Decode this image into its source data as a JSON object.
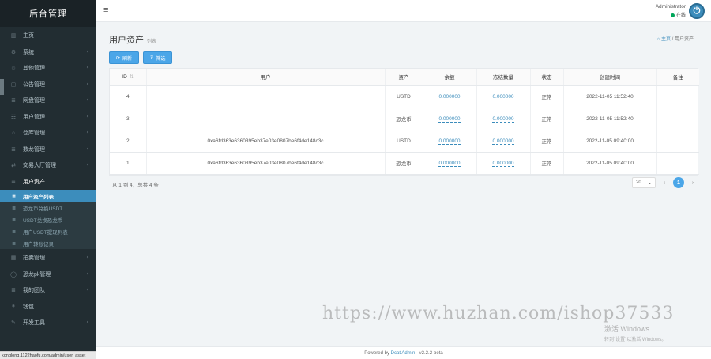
{
  "brand": "后台管理",
  "menu_top": [
    {
      "label": "主页",
      "icon": "dashboard-icon",
      "glyph": "▥",
      "arrow": false
    },
    {
      "label": "系统",
      "icon": "gear-icon",
      "glyph": "⚙",
      "arrow": true
    },
    {
      "label": "其他管理",
      "icon": "user-icon",
      "glyph": "☺",
      "arrow": true
    },
    {
      "label": "公告管理",
      "icon": "calendar-icon",
      "glyph": "▢",
      "arrow": true
    },
    {
      "label": "网盘管理",
      "icon": "list-icon",
      "glyph": "≣",
      "arrow": true
    },
    {
      "label": "用户管理",
      "icon": "users-icon",
      "glyph": "☷",
      "arrow": true
    },
    {
      "label": "仓库管理",
      "icon": "bank-icon",
      "glyph": "⌂",
      "arrow": true
    },
    {
      "label": "数龙管理",
      "icon": "list-icon",
      "glyph": "≣",
      "arrow": true
    },
    {
      "label": "交易大厅管理",
      "icon": "exchange-icon",
      "glyph": "⇄",
      "arrow": true
    },
    {
      "label": "用户资产",
      "icon": "list-icon",
      "glyph": "≣",
      "arrow": false,
      "open": true
    }
  ],
  "submenu": [
    {
      "label": "用户资产列表",
      "active": true
    },
    {
      "label": "恐龙币兑换USDT",
      "active": false
    },
    {
      "label": "USDT兑换恐龙币",
      "active": false
    },
    {
      "label": "用户USDT提现列表",
      "active": false
    },
    {
      "label": "用户转账记录",
      "active": false
    }
  ],
  "menu_bottom": [
    {
      "label": "拍卖管理",
      "icon": "grid-icon",
      "glyph": "▦",
      "arrow": true
    },
    {
      "label": "恐龙pk管理",
      "icon": "circle-icon",
      "glyph": "◯",
      "arrow": true
    },
    {
      "label": "我的团队",
      "icon": "list-icon",
      "glyph": "≣",
      "arrow": true
    },
    {
      "label": "钱包",
      "icon": "yen-icon",
      "glyph": "¥",
      "arrow": false
    },
    {
      "label": "开发工具",
      "icon": "tools-icon",
      "glyph": "✎",
      "arrow": true
    }
  ],
  "header": {
    "username": "Administrator",
    "status": "在线"
  },
  "page": {
    "title": "用户资产",
    "subtitle": "列表",
    "breadcrumb_home": "主页",
    "breadcrumb_current": "用户资产"
  },
  "toolbar": {
    "refresh": "刷新",
    "filter": "筛选"
  },
  "table": {
    "columns": [
      "ID",
      "用户",
      "资产",
      "余额",
      "冻结数量",
      "状态",
      "创建时间",
      "备注"
    ],
    "rows": [
      {
        "id": "4",
        "user": "",
        "asset": "USTD",
        "balance": "0.000000",
        "frozen": "0.000000",
        "status": "正常",
        "created": "2022-11-05 11:52:40",
        "remark": ""
      },
      {
        "id": "3",
        "user": "",
        "asset": "恐龙币",
        "balance": "0.000000",
        "frozen": "0.000000",
        "status": "正常",
        "created": "2022-11-05 11:52:40",
        "remark": ""
      },
      {
        "id": "2",
        "user": "0xa6fd363e6360395eb37e03e0807be6f4de148c3c",
        "asset": "USTD",
        "balance": "0.000000",
        "frozen": "0.000000",
        "status": "正常",
        "created": "2022-11-05 09:40:00",
        "remark": ""
      },
      {
        "id": "1",
        "user": "0xa6fd363e6360395eb37e03e0807be6f4de148c3c",
        "asset": "恐龙币",
        "balance": "0.000000",
        "frozen": "0.000000",
        "status": "正常",
        "created": "2022-11-05 09:40:00",
        "remark": ""
      }
    ]
  },
  "pager": {
    "info": "从 1 到 4，总共 4 条",
    "page_size": "20",
    "current": "1",
    "prev": "‹",
    "next": "›"
  },
  "watermark": "https://www.huzhan.com/ishop37533",
  "activate": {
    "line1": "激活 Windows",
    "line2": "转到\"设置\"以激活 Windows。"
  },
  "footer": {
    "prefix": "Powered by",
    "link": "Dcat Admin",
    "version": "· v2.2.2-beta"
  },
  "statusbar_url": "konglong.1122haofu.com/admin/user_asset",
  "colors": {
    "sidebar_bg": "#222d32",
    "accent": "#4ba6e8",
    "active_item": "#3c8dbc",
    "online": "#00a65a"
  }
}
